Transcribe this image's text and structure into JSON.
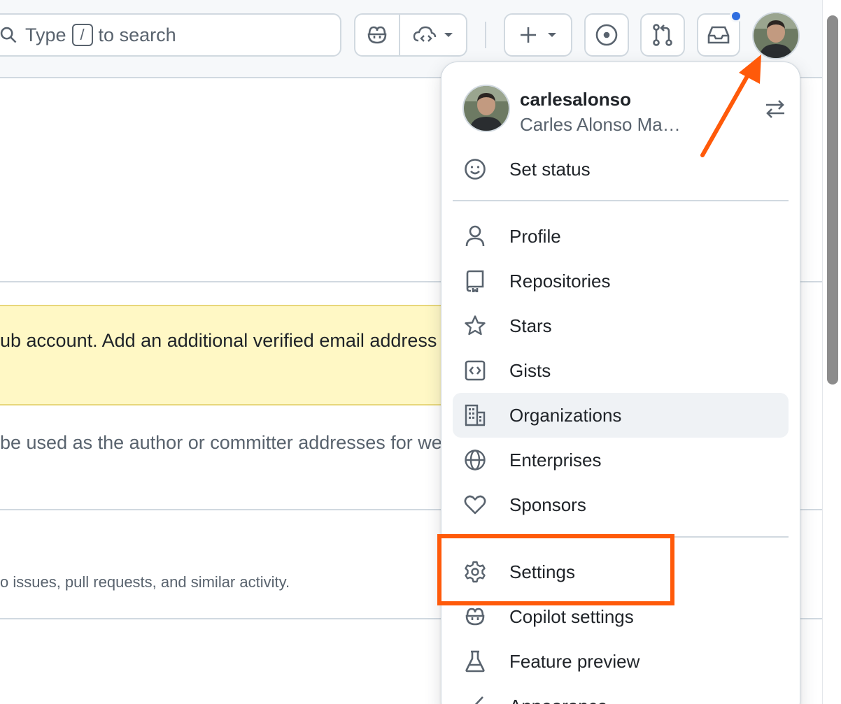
{
  "header": {
    "search": {
      "prefix": "Type",
      "key": "/",
      "suffix": "to search"
    }
  },
  "content": {
    "flash_text": "ub account. Add an additional verified email address",
    "muted_text": "be used as the author or committer addresses for we",
    "note_text": "o issues, pull requests, and similar activity."
  },
  "menu": {
    "username": "carlesalonso",
    "fullname": "Carles Alonso Ma…",
    "items": [
      {
        "label": "Set status",
        "icon": "smiley-icon"
      },
      {
        "label": "Profile",
        "icon": "person-icon"
      },
      {
        "label": "Repositories",
        "icon": "repo-icon"
      },
      {
        "label": "Stars",
        "icon": "star-icon"
      },
      {
        "label": "Gists",
        "icon": "code-square-icon"
      },
      {
        "label": "Organizations",
        "icon": "organization-icon"
      },
      {
        "label": "Enterprises",
        "icon": "globe-icon"
      },
      {
        "label": "Sponsors",
        "icon": "heart-icon"
      },
      {
        "label": "Settings",
        "icon": "gear-icon"
      },
      {
        "label": "Copilot settings",
        "icon": "copilot-icon"
      },
      {
        "label": "Feature preview",
        "icon": "beaker-icon"
      },
      {
        "label": "Appearance",
        "icon": "paintbrush-icon"
      }
    ]
  },
  "annotation": {
    "highlight_color": "#ff5a0a",
    "arrow_color": "#ff5a0a"
  },
  "colors": {
    "header_bg": "#f6f8fa",
    "border": "#d1d9e0",
    "flash_bg": "#fff8c5",
    "notification": "#2f6ee0"
  }
}
